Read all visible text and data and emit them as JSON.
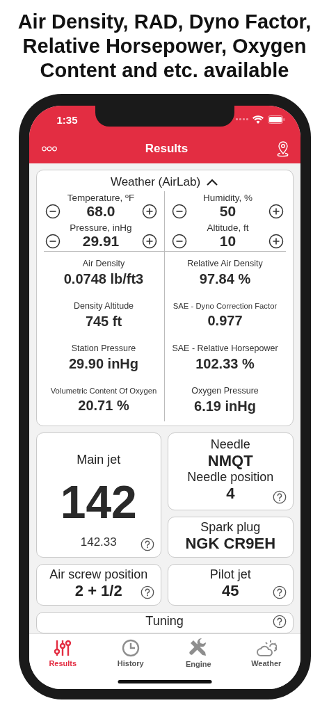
{
  "headline": "Air Density, RAD, Dyno Factor,\nRelative Horsepower, Oxygen\nContent and etc. available",
  "status_bar": {
    "time": "1:35"
  },
  "nav_bar": {
    "title": "Results"
  },
  "weather": {
    "title": "Weather (AirLab)",
    "expanded": true,
    "inputs": [
      {
        "label": "Temperature, ºF",
        "value": "68.0"
      },
      {
        "label": "Humidity, %",
        "value": "50"
      },
      {
        "label": "Pressure, inHg",
        "value": "29.91"
      },
      {
        "label": "Altitude, ft",
        "value": "10"
      }
    ],
    "metrics": [
      {
        "label": "Air Density",
        "value": "0.0748 lb/ft3"
      },
      {
        "label": "Relative Air Density",
        "value": "97.84 %"
      },
      {
        "label": "Density Altitude",
        "value": "745 ft"
      },
      {
        "label": "SAE - Dyno Correction Factor",
        "value": "0.977"
      },
      {
        "label": "Station Pressure",
        "value": "29.90 inHg"
      },
      {
        "label": "SAE - Relative Horsepower",
        "value": "102.33 %"
      },
      {
        "label": "Volumetric Content Of Oxygen",
        "value": "20.71 %"
      },
      {
        "label": "Oxygen Pressure",
        "value": "6.19 inHg"
      }
    ]
  },
  "main_jet": {
    "label": "Main jet",
    "value": "142",
    "precise": "142.33"
  },
  "needle": {
    "label": "Needle",
    "value": "NMQT",
    "position_label": "Needle position",
    "position_value": "4"
  },
  "spark_plug": {
    "label": "Spark plug",
    "value": "NGK CR9EH"
  },
  "air_screw": {
    "label": "Air screw position",
    "value": "2 + 1/2"
  },
  "pilot_jet": {
    "label": "Pilot jet",
    "value": "45"
  },
  "tuning": {
    "label": "Tuning"
  },
  "tabs": [
    {
      "label": "Results",
      "selected": true
    },
    {
      "label": "History",
      "selected": false
    },
    {
      "label": "Engine",
      "selected": false
    },
    {
      "label": "Weather",
      "selected": false
    }
  ]
}
